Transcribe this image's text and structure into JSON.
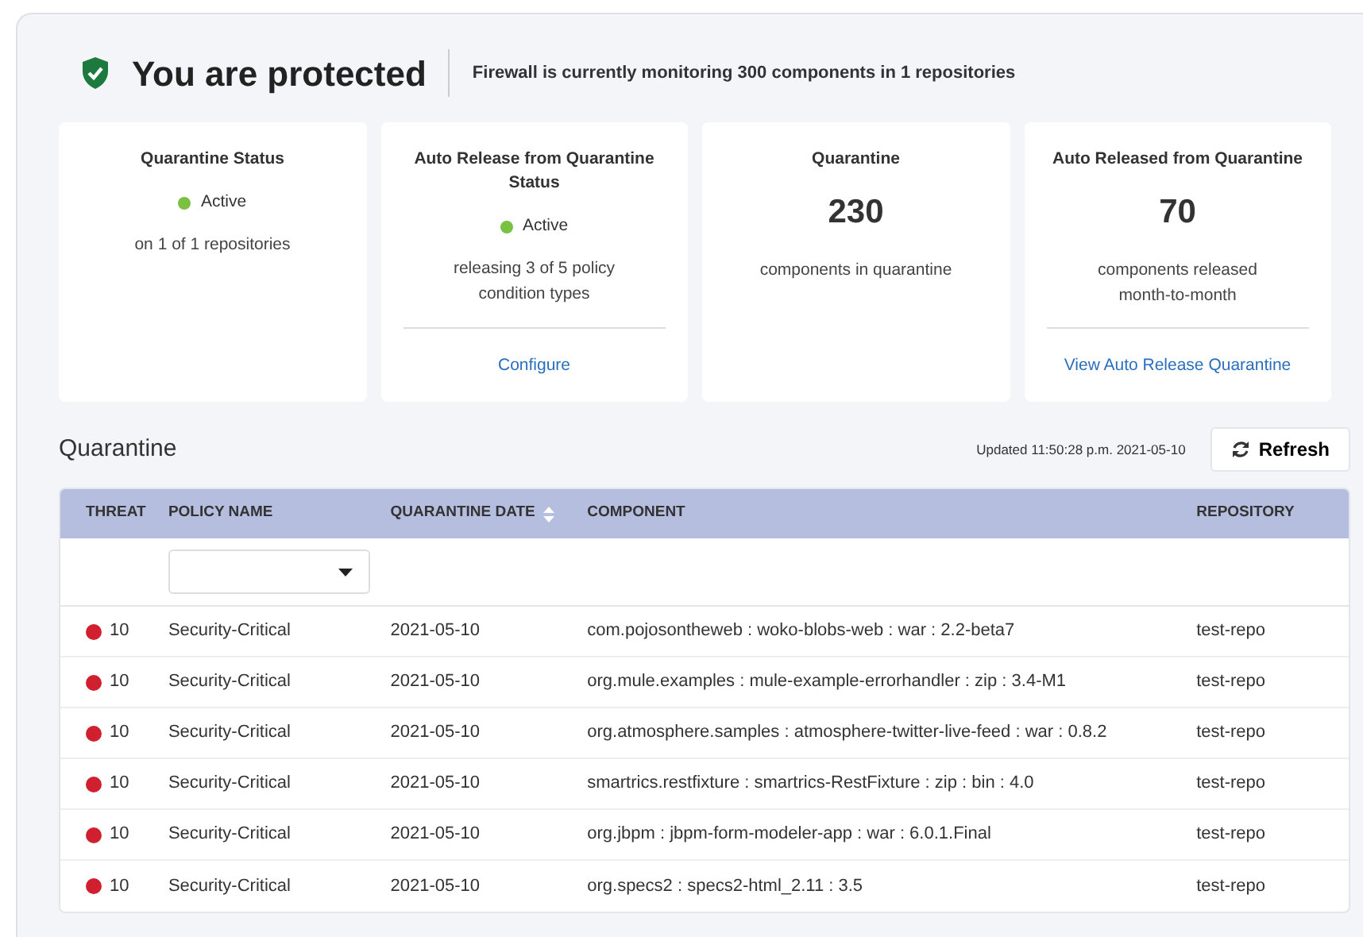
{
  "header": {
    "title": "You are protected",
    "subtitle": "Firewall is currently monitoring 300 components in 1 repositories"
  },
  "cards": [
    {
      "kind": "status",
      "title": "Quarantine Status",
      "status": "Active",
      "color": "#7ac142",
      "detail": "on 1 of 1 repositories"
    },
    {
      "kind": "status",
      "title": "Auto Release from Quarantine Status",
      "status": "Active",
      "color": "#7ac142",
      "detail": "releasing 3 of 5 policy condition types",
      "link": "Configure"
    },
    {
      "kind": "count",
      "title": "Quarantine",
      "count": "230",
      "detail": "components in quarantine"
    },
    {
      "kind": "count",
      "title": "Auto Released from Quarantine",
      "count": "70",
      "detail": "components released month-to-month",
      "link": "View Auto Release Quarantine"
    }
  ],
  "quarantine": {
    "title": "Quarantine",
    "updated": "Updated 11:50:28 p.m. 2021-05-10",
    "refresh": "Refresh",
    "columns": [
      {
        "label": "THREAT"
      },
      {
        "label": "POLICY NAME"
      },
      {
        "label": "QUARANTINE DATE",
        "sortable": true
      },
      {
        "label": "COMPONENT"
      },
      {
        "label": "REPOSITORY"
      }
    ],
    "rows": [
      {
        "threat": "10",
        "color": "#d0202f",
        "policy": "Security-Critical",
        "date": "2021-05-10",
        "component": "com.pojosontheweb : woko-blobs-web : war : 2.2-beta7",
        "repository": "test-repo"
      },
      {
        "threat": "10",
        "color": "#d0202f",
        "policy": "Security-Critical",
        "date": "2021-05-10",
        "component": "org.mule.examples : mule-example-errorhandler : zip : 3.4-M1",
        "repository": "test-repo"
      },
      {
        "threat": "10",
        "color": "#d0202f",
        "policy": "Security-Critical",
        "date": "2021-05-10",
        "component": "org.atmosphere.samples : atmosphere-twitter-live-feed : war : 0.8.2",
        "repository": "test-repo"
      },
      {
        "threat": "10",
        "color": "#d0202f",
        "policy": "Security-Critical",
        "date": "2021-05-10",
        "component": "smartrics.restfixture : smartrics-RestFixture : zip : bin : 4.0",
        "repository": "test-repo"
      },
      {
        "threat": "10",
        "color": "#d0202f",
        "policy": "Security-Critical",
        "date": "2021-05-10",
        "component": "org.jbpm : jbpm-form-modeler-app : war : 6.0.1.Final",
        "repository": "test-repo"
      },
      {
        "threat": "10",
        "color": "#d0202f",
        "policy": "Security-Critical",
        "date": "2021-05-10",
        "component": "org.specs2 : specs2-html_2.11 : 3.5",
        "repository": "test-repo"
      }
    ]
  }
}
